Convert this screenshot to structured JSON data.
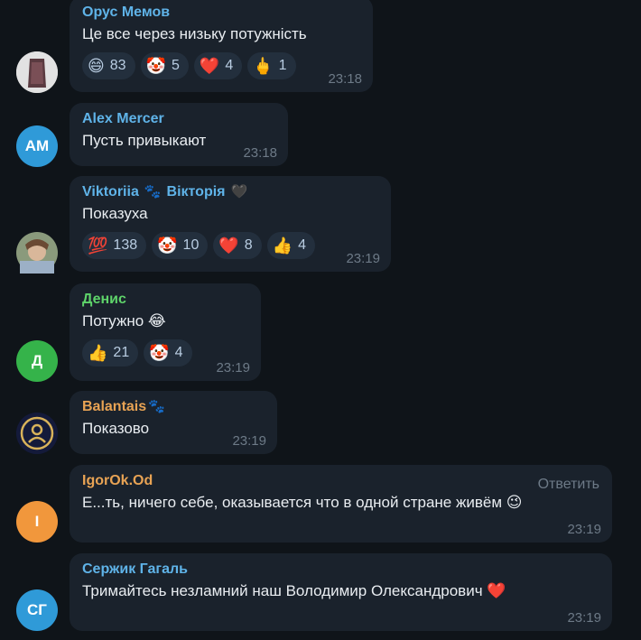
{
  "colors": {
    "background": "#0f1419",
    "bubble": "#1a222c",
    "reaction_bg": "#232f3d",
    "time": "#6d7a87"
  },
  "messages": [
    {
      "sender": "Орус Мемов",
      "sender_color": "#5fb3e8",
      "text": "Це все через низьку потужність",
      "time": "23:18",
      "avatar_type": "photo",
      "reactions": [
        {
          "emoji": "😄",
          "count": "83"
        },
        {
          "emoji": "🤡",
          "count": "5"
        },
        {
          "emoji": "❤️",
          "count": "4"
        },
        {
          "emoji": "🖕",
          "count": "1"
        }
      ]
    },
    {
      "sender": "Alex Mercer",
      "sender_color": "#5fb3e8",
      "text": "Пусть привыкают",
      "time": "23:18",
      "avatar_type": "initials",
      "avatar_initials": "AM",
      "avatar_color": "#2f9ad8"
    },
    {
      "sender": "Viktoriia",
      "sender_extra": "Вікторія",
      "sender_color": "#5fb3e8",
      "paw_emoji": "🐾",
      "heart_emoji": "🖤",
      "text": "Показуха",
      "time": "23:19",
      "avatar_type": "photo",
      "reactions": [
        {
          "emoji": "💯",
          "count": "138"
        },
        {
          "emoji": "🤡",
          "count": "10"
        },
        {
          "emoji": "❤️",
          "count": "8"
        },
        {
          "emoji": "👍",
          "count": "4"
        }
      ]
    },
    {
      "sender": "Денис",
      "sender_color": "#5ed36a",
      "text": "Потужно",
      "text_emoji": "😂",
      "time": "23:19",
      "avatar_type": "initials",
      "avatar_initials": "Д",
      "avatar_color": "#35b34a",
      "reactions": [
        {
          "emoji": "👍",
          "count": "21"
        },
        {
          "emoji": "🤡",
          "count": "4"
        }
      ]
    },
    {
      "sender": "Balantais",
      "paw_emoji": "🐾",
      "sender_color": "#e8a354",
      "text": "Показово",
      "time": "23:19",
      "avatar_type": "logo"
    },
    {
      "sender": "IgorOk.Od",
      "sender_color": "#e8a354",
      "text": "Е...ть, ничего себе, оказывается что в одной стране живём",
      "text_emoji": "😉",
      "time": "23:19",
      "reply_label": "Ответить",
      "avatar_type": "initials",
      "avatar_initials": "I",
      "avatar_color": "#f1973c"
    },
    {
      "sender": "Сержик Гагаль",
      "sender_color": "#5fb3e8",
      "text": "Тримайтесь незламний наш Володимир Олександрович",
      "text_emoji": "❤️",
      "time": "23:19",
      "avatar_type": "initials",
      "avatar_initials": "СГ",
      "avatar_color": "#2f9ad8"
    }
  ]
}
